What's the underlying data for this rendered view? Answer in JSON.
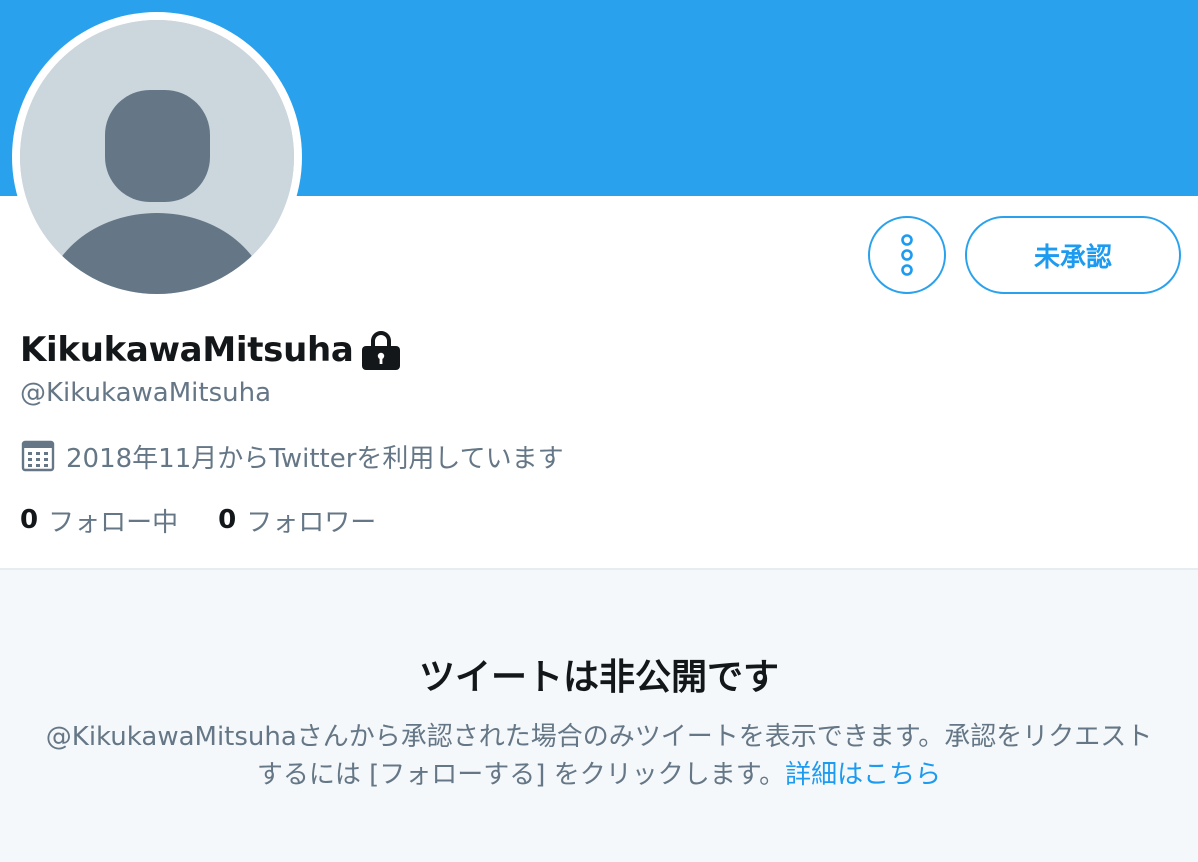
{
  "colors": {
    "accent": "#1d9bf0",
    "banner": "#2aa1ec",
    "primary_text": "#14171a",
    "secondary_text": "#657786",
    "avatar_bg": "#ccd6dd",
    "avatar_fg": "#657786",
    "section_bg": "#f5f8fa"
  },
  "icons": {
    "avatar": "default-avatar-icon",
    "more": "more-vertical-icon",
    "lock": "lock-icon",
    "calendar": "calendar-icon"
  },
  "profile": {
    "display_name": "KikukawaMitsuha",
    "handle": "@KikukawaMitsuha",
    "joined": "2018年11月からTwitterを利用しています",
    "protected": true
  },
  "actions": {
    "pending_label": "未承認"
  },
  "stats": {
    "following_count": "0",
    "following_label": "フォロー中",
    "followers_count": "0",
    "followers_label": "フォロワー"
  },
  "protected_notice": {
    "title": "ツイートは非公開です",
    "body": "@KikukawaMitsuhaさんから承認された場合のみツイートを表示できます。承認をリクエストするには [フォローする] をクリックします。",
    "learn_more": "詳細はこちら"
  }
}
